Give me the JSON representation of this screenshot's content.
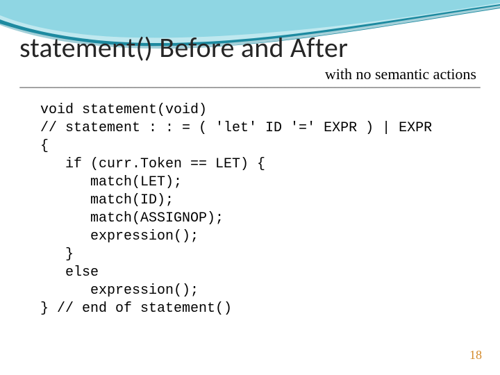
{
  "slide": {
    "title": "statement() Before and After",
    "subtitle": "with no semantic actions",
    "page_number": "18",
    "code_lines": [
      "void statement(void)",
      "// statement : : = ( 'let' ID '=' EXPR ) | EXPR",
      "{",
      "   if (curr.Token == LET) {",
      "      match(LET);",
      "      match(ID);",
      "      match(ASSIGNOP);",
      "      expression();",
      "   }",
      "   else",
      "      expression();",
      "} // end of statement()"
    ]
  }
}
